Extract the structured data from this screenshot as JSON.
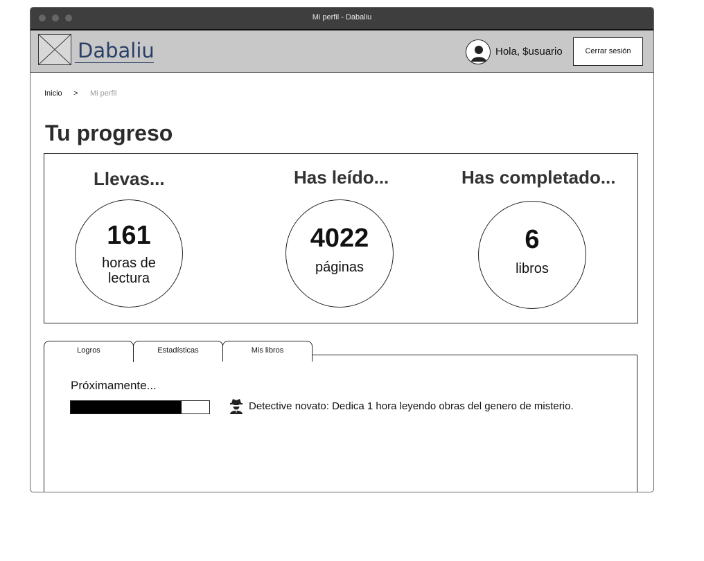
{
  "window": {
    "title": "Mi perfil - Dabaliu"
  },
  "header": {
    "logo_text": "Dabaliu",
    "greeting": "Hola, $usuario",
    "logout_label": "Cerrar sesión"
  },
  "breadcrumb": {
    "home": "Inicio",
    "separator": ">",
    "current": "Mi perfil"
  },
  "page": {
    "title": "Tu progreso"
  },
  "stats": [
    {
      "label": "Llevas...",
      "value": "161",
      "unit": "horas de lectura"
    },
    {
      "label": "Has leído...",
      "value": "4022",
      "unit": "páginas"
    },
    {
      "label": "Has completado...",
      "value": "6",
      "unit": "libros"
    }
  ],
  "tabs": [
    {
      "label": "Logros",
      "active": true
    },
    {
      "label": "Estadísticas",
      "active": false
    },
    {
      "label": "Mis libros",
      "active": false
    }
  ],
  "achievements": {
    "heading": "Próximamente...",
    "progress": 0.8,
    "icon": "detective-icon",
    "text": "Detective novato: Dedica 1 hora leyendo obras del genero de misterio."
  }
}
